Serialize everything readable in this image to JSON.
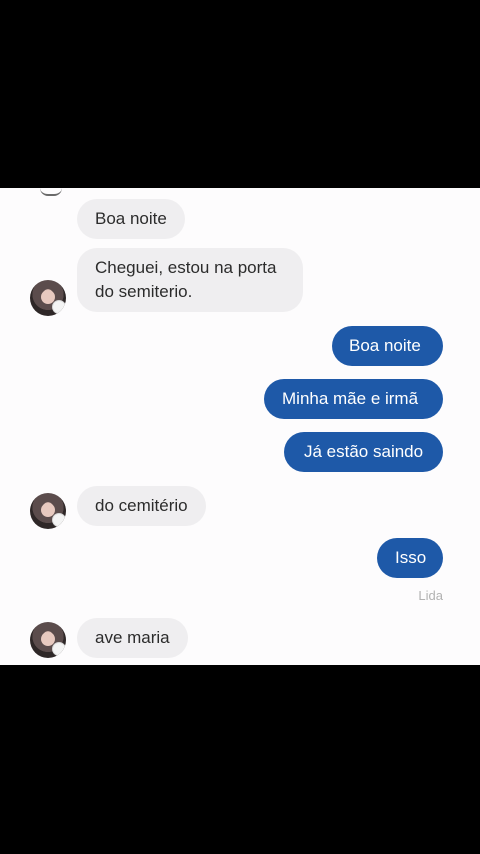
{
  "messages": [
    {
      "id": "m1",
      "direction": "incoming",
      "text": "Boa noite"
    },
    {
      "id": "m2",
      "direction": "incoming",
      "lines": [
        "Cheguei, estou na porta",
        "do semiterio."
      ]
    },
    {
      "id": "m3",
      "direction": "outgoing",
      "text": "Boa noite"
    },
    {
      "id": "m4",
      "direction": "outgoing",
      "text": "Minha mãe e irmã"
    },
    {
      "id": "m5",
      "direction": "outgoing",
      "text": "Já estão saindo"
    },
    {
      "id": "m6",
      "direction": "incoming",
      "text": "do cemitério"
    },
    {
      "id": "m7",
      "direction": "outgoing",
      "text": "Isso"
    },
    {
      "id": "m8",
      "direction": "incoming",
      "text": "ave maria"
    }
  ],
  "read_receipt": "Lida",
  "colors": {
    "outgoing_bubble": "#1e59a8",
    "incoming_bubble": "#efeef0",
    "chat_background": "#fdfcfd",
    "letterbox": "#000000"
  }
}
